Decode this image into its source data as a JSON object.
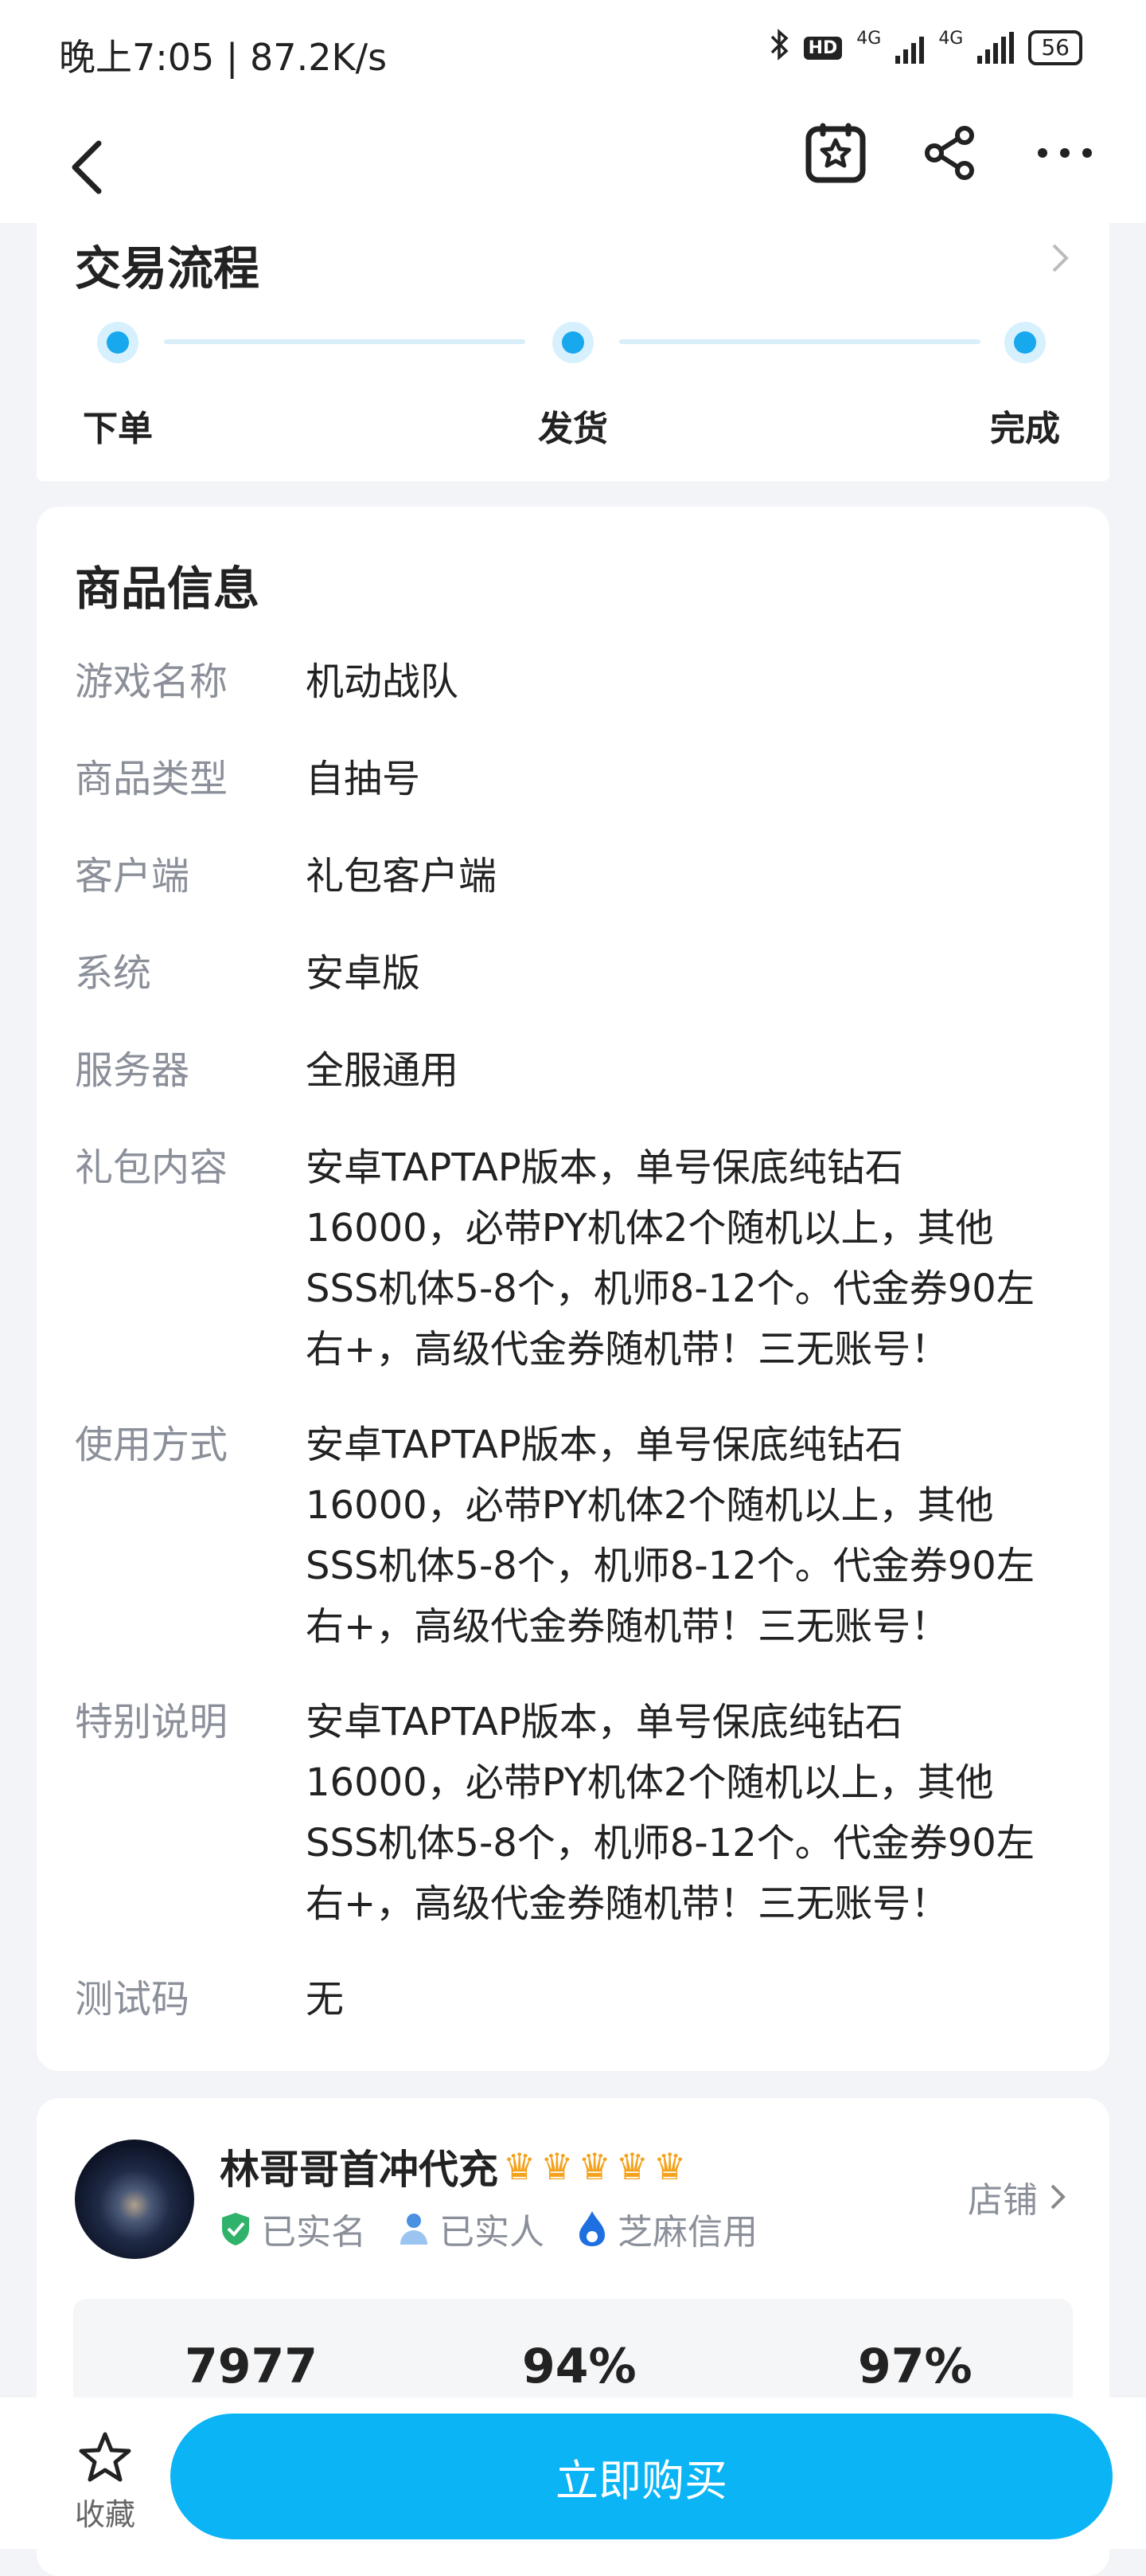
{
  "status": {
    "time": "晚上7:05 | 87.2K/s",
    "hd": "HD",
    "net1": "4G",
    "net2": "4G",
    "battery": "56"
  },
  "flow": {
    "title": "交易流程",
    "steps": [
      "下单",
      "发货",
      "完成"
    ]
  },
  "info": {
    "title": "商品信息",
    "rows": [
      {
        "k": "游戏名称",
        "v": "机动战队"
      },
      {
        "k": "商品类型",
        "v": "自抽号"
      },
      {
        "k": "客户端",
        "v": "礼包客户端"
      },
      {
        "k": "系统",
        "v": "安卓版"
      },
      {
        "k": "服务器",
        "v": "全服通用"
      },
      {
        "k": "礼包内容",
        "v": "安卓TAPTAP版本，单号保底纯钻石16000，必带PY机体2个随机以上，其他SSS机体5-8个，机师8-12个。代金券90左右+，高级代金券随机带！三无账号！"
      },
      {
        "k": "使用方式",
        "v": "安卓TAPTAP版本，单号保底纯钻石16000，必带PY机体2个随机以上，其他SSS机体5-8个，机师8-12个。代金券90左右+，高级代金券随机带！三无账号！"
      },
      {
        "k": "特别说明",
        "v": "安卓TAPTAP版本，单号保底纯钻石16000，必带PY机体2个随机以上，其他SSS机体5-8个，机师8-12个。代金券90左右+，高级代金券随机带！三无账号！"
      },
      {
        "k": "测试码",
        "v": "无"
      }
    ]
  },
  "shop": {
    "name": "林哥哥首冲代充",
    "crown_count": 5,
    "badges": [
      "已实名",
      "已实人",
      "芝麻信用"
    ],
    "link_label": "店铺",
    "stats": [
      "7977",
      "94%",
      "97%"
    ]
  },
  "bottom": {
    "fav_label": "收藏",
    "buy_label": "立即购买"
  },
  "colors": {
    "accent": "#0ab4f5",
    "step": "#17a8ee",
    "crown": "#f4a21c",
    "verified": "#2fb36b"
  }
}
